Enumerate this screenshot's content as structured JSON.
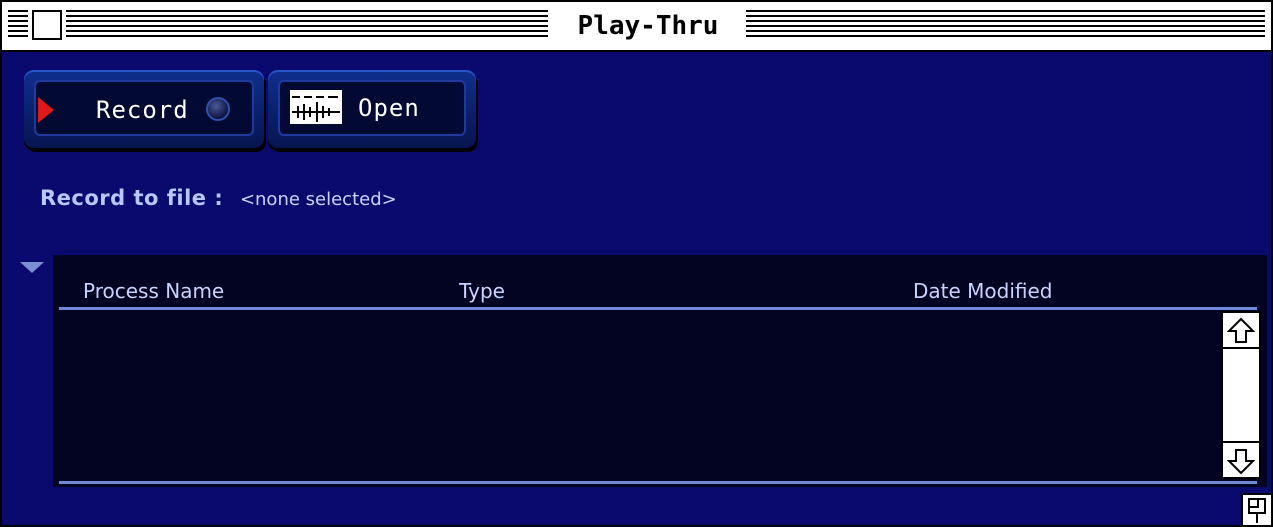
{
  "window": {
    "title": "Play-Thru"
  },
  "toolbar": {
    "record_label": "Record",
    "open_label": "Open"
  },
  "record_to_file": {
    "label": "Record to file :",
    "value": "<none selected>"
  },
  "list": {
    "columns": [
      "Process Name",
      "Type",
      "Date Modified"
    ],
    "rows": []
  },
  "colors": {
    "window_background": "#0a0a6e",
    "list_background": "#020421",
    "accent_line": "#6e8ad8",
    "label_text": "#b8c8ff",
    "record_indicator": "#e01818"
  },
  "icons": {
    "close_box": "close-box-icon",
    "play": "play-triangle-icon",
    "record_led": "record-led-icon",
    "waveform": "waveform-icon",
    "disclosure": "disclosure-triangle-icon",
    "scroll_up": "up-arrow-icon",
    "scroll_down": "down-arrow-icon",
    "resize": "resize-icon"
  }
}
